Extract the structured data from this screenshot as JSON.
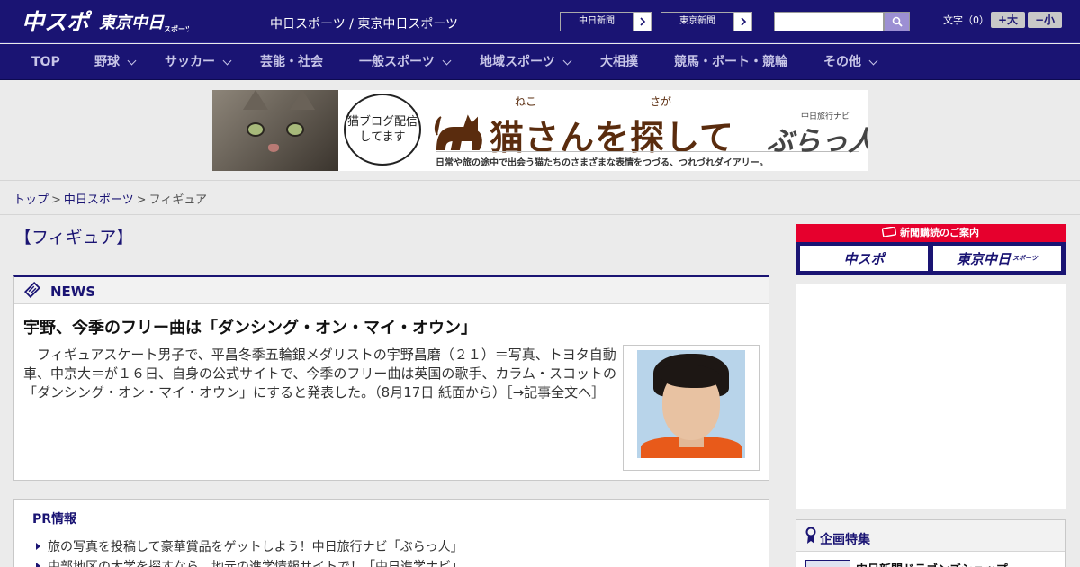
{
  "header": {
    "site_title": "中日スポーツ / 東京中日スポーツ",
    "paper_buttons": [
      {
        "label": "中日新聞"
      },
      {
        "label": "東京新聞"
      }
    ],
    "search_placeholder": "",
    "font_size_label": "文字（0）",
    "font_larger": "+大",
    "font_smaller": "−小",
    "logo_chuspo": "中スポ",
    "logo_tokyo": "東京中日",
    "logo_sports": "スポーツ"
  },
  "nav": {
    "items": [
      {
        "label": "TOP",
        "has_dropdown": false
      },
      {
        "label": "野球",
        "has_dropdown": true
      },
      {
        "label": "サッカー",
        "has_dropdown": true
      },
      {
        "label": "芸能・社会",
        "has_dropdown": false
      },
      {
        "label": "一般スポーツ",
        "has_dropdown": true
      },
      {
        "label": "地域スポーツ",
        "has_dropdown": true
      },
      {
        "label": "大相撲",
        "has_dropdown": false
      },
      {
        "label": "競馬・ボート・競輪",
        "has_dropdown": false
      },
      {
        "label": "その他",
        "has_dropdown": true
      }
    ]
  },
  "banner": {
    "bubble_text": "猫ブログ配信してます",
    "title": "猫さんを探して",
    "ruby_neko": "ねこ",
    "ruby_saga": "さが",
    "subtitle": "日常や旅の途中で出会う猫たちのさまざまな表情をつづる、つれづれダイアリー。",
    "brand_small": "中日旅行ナビ",
    "brand": "ぶらっ人"
  },
  "breadcrumb": {
    "items": [
      "トップ",
      "中日スポーツ",
      "フィギュア"
    ],
    "separator": ">"
  },
  "main": {
    "heading": "【フィギュア】",
    "news": {
      "section_label": "NEWS",
      "title": "宇野、今季のフリー曲は「ダンシング・オン・マイ・オウン」",
      "body": "　フィギュアスケート男子で、平昌冬季五輪銀メダリストの宇野昌磨（２１）＝写真、トヨタ自動車、中京大＝が１６日、自身の公式サイトで、今季のフリー曲は英国の歌手、カラム・スコットの「ダンシング・オン・マイ・オウン」にすると発表した。（8月17日 紙面から）",
      "more_link": "［→記事全文へ］"
    },
    "pr": {
      "title": "PR情報",
      "items": [
        "旅の写真を投稿して豪華賞品をゲットしよう！中日旅行ナビ「ぶらっ人」",
        "中部地区の大学を探すなら、地元の進学情報サイトで！「中日進学ナビ」"
      ]
    }
  },
  "sidebar": {
    "subscription_head": "新聞購読のご案内",
    "sub_logos": [
      "中スポ",
      "東京中日"
    ],
    "sub_logo_suffix": "スポーツ",
    "feature_label": "企画特集",
    "feature_item": "中日新聞ドラゴンズショップ"
  },
  "colors": {
    "brand_navy": "#1a1473",
    "accent_red": "#e6002d",
    "search_button": "#9c8fd3"
  }
}
